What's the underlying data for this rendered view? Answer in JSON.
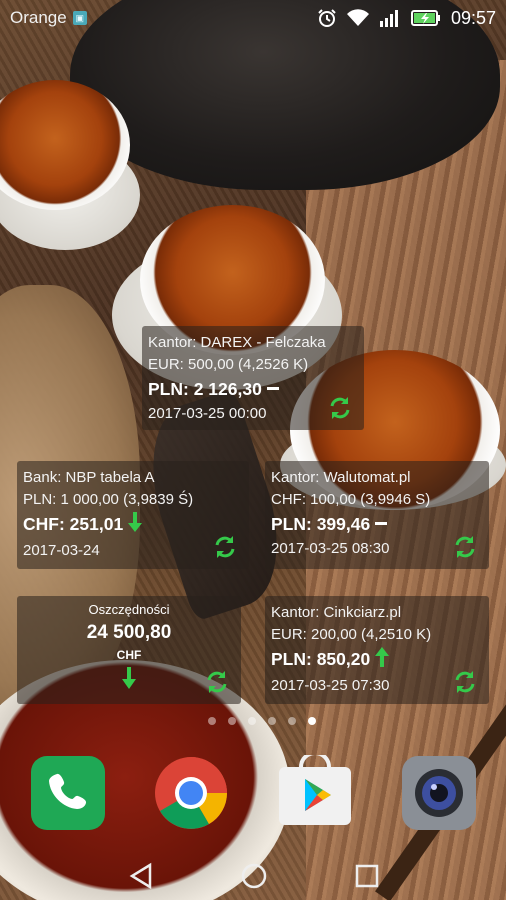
{
  "status_bar": {
    "carrier": "Orange",
    "carrier_badge_icon": "sim-badge-icon",
    "time": "09:57",
    "icons": [
      "alarm-clock-icon",
      "wifi-icon",
      "signal-icon",
      "battery-charging-icon"
    ]
  },
  "widgets": {
    "darex": {
      "source": "Kantor: DAREX - Felczaka",
      "rate_line": "EUR: 500,00 (4,2526 K)",
      "result": "PLN: 2 126,30",
      "trend": "flat",
      "updated": "2017-03-25 00:00"
    },
    "nbp": {
      "source": "Bank: NBP tabela A",
      "rate_line": "PLN: 1 000,00 (3,9839 Ś)",
      "result": "CHF: 251,01",
      "trend": "down",
      "updated": "2017-03-24"
    },
    "walutomat": {
      "source": "Kantor: Walutomat.pl",
      "rate_line": "CHF: 100,00 (3,9946 S)",
      "result": "PLN: 399,46",
      "trend": "flat",
      "updated": "2017-03-25 08:30"
    },
    "cinkciarz": {
      "source": "Kantor: Cinkciarz.pl",
      "rate_line": "EUR: 200,00 (4,2510 K)",
      "result": "PLN: 850,20",
      "trend": "up",
      "updated": "2017-03-25 07:30"
    },
    "savings": {
      "label": "Oszczędności",
      "amount": "24 500,80",
      "currency": "CHF",
      "trend": "down"
    }
  },
  "page_indicator": {
    "count": 6,
    "active_index": 5
  },
  "dock": {
    "apps": [
      "phone-icon",
      "chrome-icon",
      "play-store-icon",
      "camera-icon"
    ]
  },
  "nav_bar": {
    "buttons": [
      "back-icon",
      "home-icon",
      "recent-apps-icon"
    ]
  },
  "colors": {
    "accent_green": "#35c94a",
    "widget_bg": "rgba(40,32,28,0.55)",
    "phone_green": "#1fa855"
  }
}
